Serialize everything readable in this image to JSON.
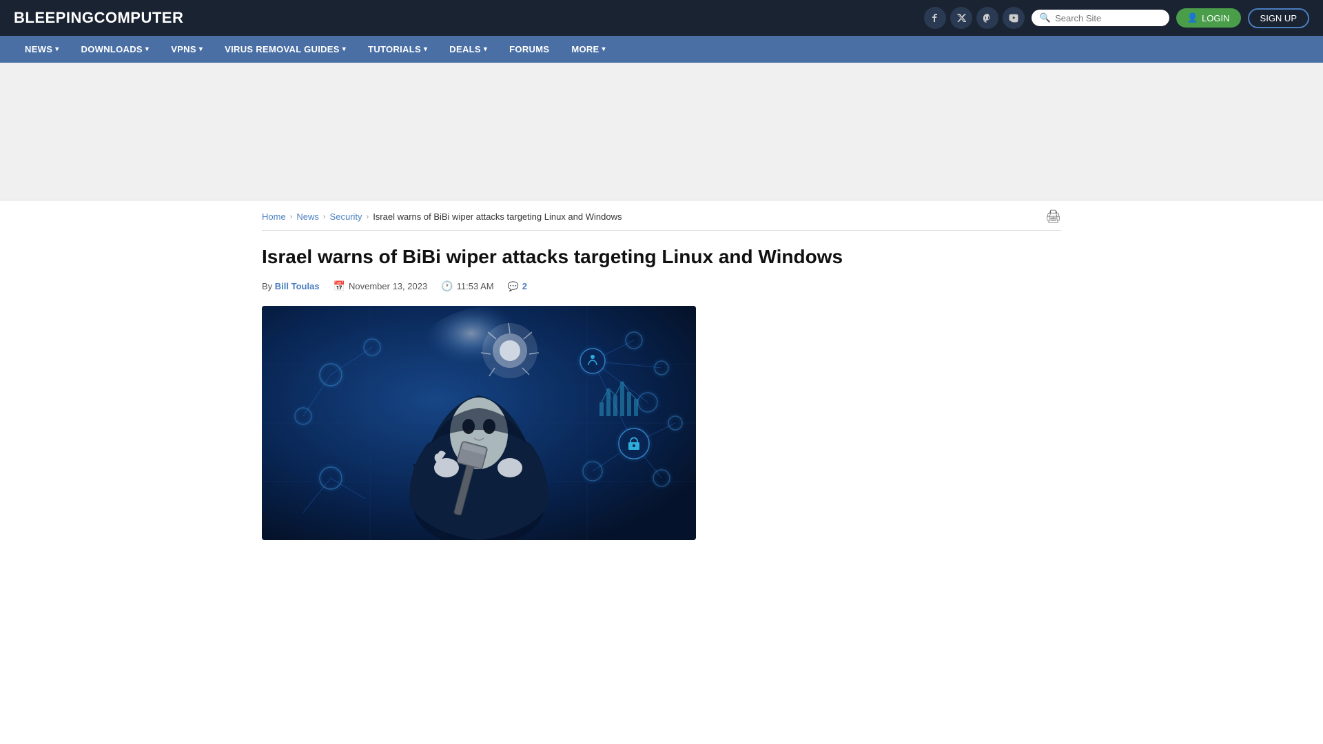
{
  "site": {
    "name_part1": "BLEEPING",
    "name_part2": "COMPUTER"
  },
  "header": {
    "search_placeholder": "Search Site",
    "login_label": "LOGIN",
    "signup_label": "SIGN UP"
  },
  "social": [
    {
      "name": "facebook",
      "icon": "f"
    },
    {
      "name": "twitter",
      "icon": "𝕏"
    },
    {
      "name": "mastodon",
      "icon": "m"
    },
    {
      "name": "youtube",
      "icon": "▶"
    }
  ],
  "nav": {
    "items": [
      {
        "label": "NEWS",
        "has_dropdown": true
      },
      {
        "label": "DOWNLOADS",
        "has_dropdown": true
      },
      {
        "label": "VPNS",
        "has_dropdown": true
      },
      {
        "label": "VIRUS REMOVAL GUIDES",
        "has_dropdown": true
      },
      {
        "label": "TUTORIALS",
        "has_dropdown": true
      },
      {
        "label": "DEALS",
        "has_dropdown": true
      },
      {
        "label": "FORUMS",
        "has_dropdown": false
      },
      {
        "label": "MORE",
        "has_dropdown": true
      }
    ]
  },
  "breadcrumb": {
    "home": "Home",
    "news": "News",
    "security": "Security",
    "current": "Israel warns of BiBi wiper attacks targeting Linux and Windows"
  },
  "article": {
    "title": "Israel warns of BiBi wiper attacks targeting Linux and Windows",
    "author": "Bill Toulas",
    "date": "November 13, 2023",
    "time": "11:53 AM",
    "comment_count": "2",
    "image_alt": "Hacker with mask and hammer - cyber security concept"
  }
}
